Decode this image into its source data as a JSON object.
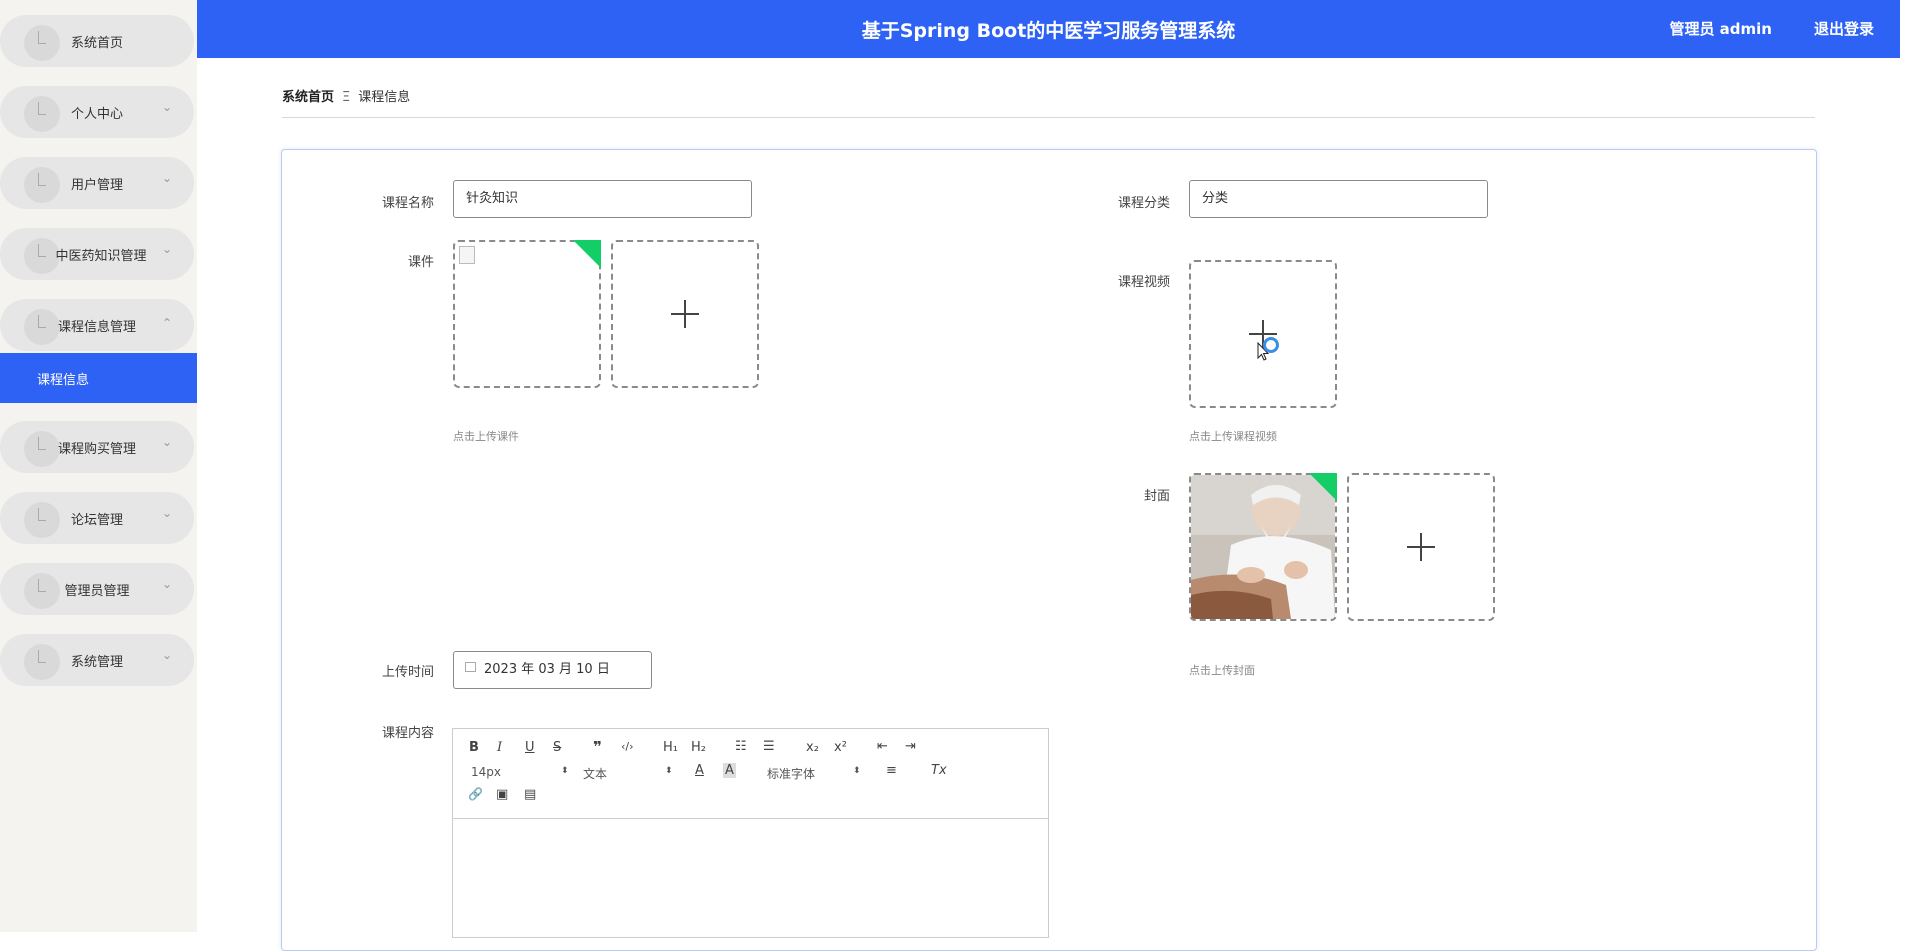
{
  "app": {
    "title": "基于Spring Boot的中医学习服务管理系统",
    "user_label": "管理员 admin",
    "logout_label": "退出登录",
    "accent": "#2e62f5"
  },
  "sidebar": {
    "items": [
      {
        "label": "系统首页",
        "chevron": ""
      },
      {
        "label": "个人中心",
        "chevron": "⌄"
      },
      {
        "label": "用户管理",
        "chevron": "⌄"
      },
      {
        "label": "中医药知识管理",
        "chevron": "⌄"
      },
      {
        "label": "课程信息管理",
        "chevron": "⌃"
      },
      {
        "label": "课程购买管理",
        "chevron": "⌄"
      },
      {
        "label": "论坛管理",
        "chevron": "⌄"
      },
      {
        "label": "管理员管理",
        "chevron": "⌄"
      },
      {
        "label": "系统管理",
        "chevron": "⌄"
      }
    ],
    "active_sub": "课程信息"
  },
  "breadcrumb": {
    "home": "系统首页",
    "separator": "Ξ",
    "current": "课程信息"
  },
  "form": {
    "name_label": "课程名称",
    "name_value": "针灸知识",
    "category_label": "课程分类",
    "category_value": "分类",
    "courseware_label": "课件",
    "courseware_hint": "点击上传课件",
    "video_label": "课程视频",
    "video_hint": "点击上传课程视频",
    "cover_label": "封面",
    "cover_hint": "点击上传封面",
    "upload_time_label": "上传时间",
    "upload_time_value": "2023 年 03 月 10 日",
    "content_label": "课程内容"
  },
  "editor": {
    "font_size": "14px",
    "paragraph": "文本",
    "font_family": "标准字体",
    "buttons": {
      "bold": "B",
      "italic": "I",
      "underline": "U",
      "strike": "S",
      "quote": "❞",
      "code": "‹/›",
      "h1": "H₁",
      "h2": "H₂",
      "ol": "☷",
      "ul": "☰",
      "sub": "x₂",
      "sup": "x²",
      "outdent": "⇤",
      "indent": "⇥",
      "color": "A",
      "bg": "A",
      "align": "≡",
      "clean": "Tx",
      "link": "🔗",
      "image": "▣",
      "video": "▤"
    }
  }
}
